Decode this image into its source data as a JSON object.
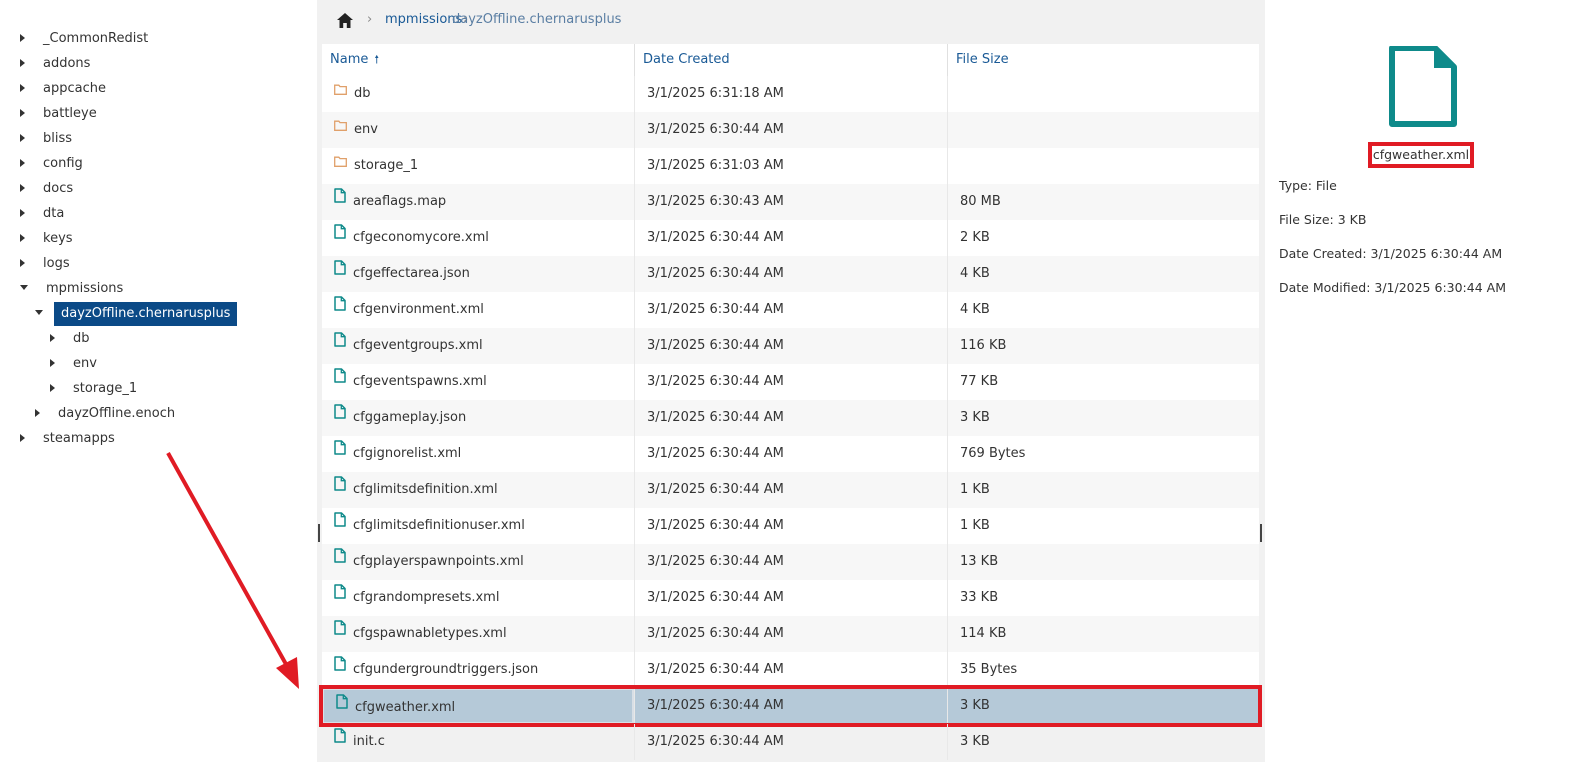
{
  "tree": [
    {
      "label": "_CommonRedist",
      "level": 0,
      "state": "closed"
    },
    {
      "label": "addons",
      "level": 0,
      "state": "closed"
    },
    {
      "label": "appcache",
      "level": 0,
      "state": "closed"
    },
    {
      "label": "battleye",
      "level": 0,
      "state": "closed"
    },
    {
      "label": "bliss",
      "level": 0,
      "state": "closed"
    },
    {
      "label": "config",
      "level": 0,
      "state": "closed"
    },
    {
      "label": "docs",
      "level": 0,
      "state": "closed"
    },
    {
      "label": "dta",
      "level": 0,
      "state": "closed"
    },
    {
      "label": "keys",
      "level": 0,
      "state": "closed"
    },
    {
      "label": "logs",
      "level": 0,
      "state": "closed"
    },
    {
      "label": "mpmissions",
      "level": 0,
      "state": "open"
    },
    {
      "label": "dayzOffline.chernarusplus",
      "level": 1,
      "state": "open",
      "selected": true
    },
    {
      "label": "db",
      "level": 2,
      "state": "closed"
    },
    {
      "label": "env",
      "level": 2,
      "state": "closed"
    },
    {
      "label": "storage_1",
      "level": 2,
      "state": "closed"
    },
    {
      "label": "dayzOffline.enoch",
      "level": 1,
      "state": "closed"
    },
    {
      "label": "steamapps",
      "level": 0,
      "state": "closed"
    }
  ],
  "breadcrumb": {
    "items": [
      "mpmissions",
      "dayzOffline.chernarusplus"
    ]
  },
  "grid": {
    "columns": {
      "name": "Name",
      "date": "Date Created",
      "size": "File Size"
    },
    "rows": [
      {
        "name": "db",
        "date": "3/1/2025 6:31:18 AM",
        "size": "",
        "type": "folder"
      },
      {
        "name": "env",
        "date": "3/1/2025 6:30:44 AM",
        "size": "",
        "type": "folder"
      },
      {
        "name": "storage_1",
        "date": "3/1/2025 6:31:03 AM",
        "size": "",
        "type": "folder"
      },
      {
        "name": "areaflags.map",
        "date": "3/1/2025 6:30:43 AM",
        "size": "80 MB",
        "type": "file"
      },
      {
        "name": "cfgeconomycore.xml",
        "date": "3/1/2025 6:30:44 AM",
        "size": "2 KB",
        "type": "file"
      },
      {
        "name": "cfgeffectarea.json",
        "date": "3/1/2025 6:30:44 AM",
        "size": "4 KB",
        "type": "file"
      },
      {
        "name": "cfgenvironment.xml",
        "date": "3/1/2025 6:30:44 AM",
        "size": "4 KB",
        "type": "file"
      },
      {
        "name": "cfgeventgroups.xml",
        "date": "3/1/2025 6:30:44 AM",
        "size": "116 KB",
        "type": "file"
      },
      {
        "name": "cfgeventspawns.xml",
        "date": "3/1/2025 6:30:44 AM",
        "size": "77 KB",
        "type": "file"
      },
      {
        "name": "cfggameplay.json",
        "date": "3/1/2025 6:30:44 AM",
        "size": "3 KB",
        "type": "file"
      },
      {
        "name": "cfgignorelist.xml",
        "date": "3/1/2025 6:30:44 AM",
        "size": "769 Bytes",
        "type": "file"
      },
      {
        "name": "cfglimitsdefinition.xml",
        "date": "3/1/2025 6:30:44 AM",
        "size": "1 KB",
        "type": "file"
      },
      {
        "name": "cfglimitsdefinitionuser.xml",
        "date": "3/1/2025 6:30:44 AM",
        "size": "1 KB",
        "type": "file"
      },
      {
        "name": "cfgplayerspawnpoints.xml",
        "date": "3/1/2025 6:30:44 AM",
        "size": "13 KB",
        "type": "file"
      },
      {
        "name": "cfgrandompresets.xml",
        "date": "3/1/2025 6:30:44 AM",
        "size": "33 KB",
        "type": "file"
      },
      {
        "name": "cfgspawnabletypes.xml",
        "date": "3/1/2025 6:30:44 AM",
        "size": "114 KB",
        "type": "file"
      },
      {
        "name": "cfgundergroundtriggers.json",
        "date": "3/1/2025 6:30:44 AM",
        "size": "35 Bytes",
        "type": "file"
      },
      {
        "name": "cfgweather.xml",
        "date": "3/1/2025 6:30:44 AM",
        "size": "3 KB",
        "type": "file",
        "selected": true
      },
      {
        "name": "init.c",
        "date": "3/1/2025 6:30:44 AM",
        "size": "3 KB",
        "type": "file"
      }
    ]
  },
  "details": {
    "name": "cfgweather.xml",
    "type": "Type: File",
    "size": "File Size: 3 KB",
    "created": "Date Created: 3/1/2025 6:30:44 AM",
    "modified": "Date Modified: 3/1/2025 6:30:44 AM"
  },
  "colors": {
    "accent": "#0b4a87",
    "highlight": "#e01b24",
    "file_icon": "#0e8a8a",
    "folder_icon": "#e0a06a",
    "selected_row": "#b5c9d8"
  }
}
